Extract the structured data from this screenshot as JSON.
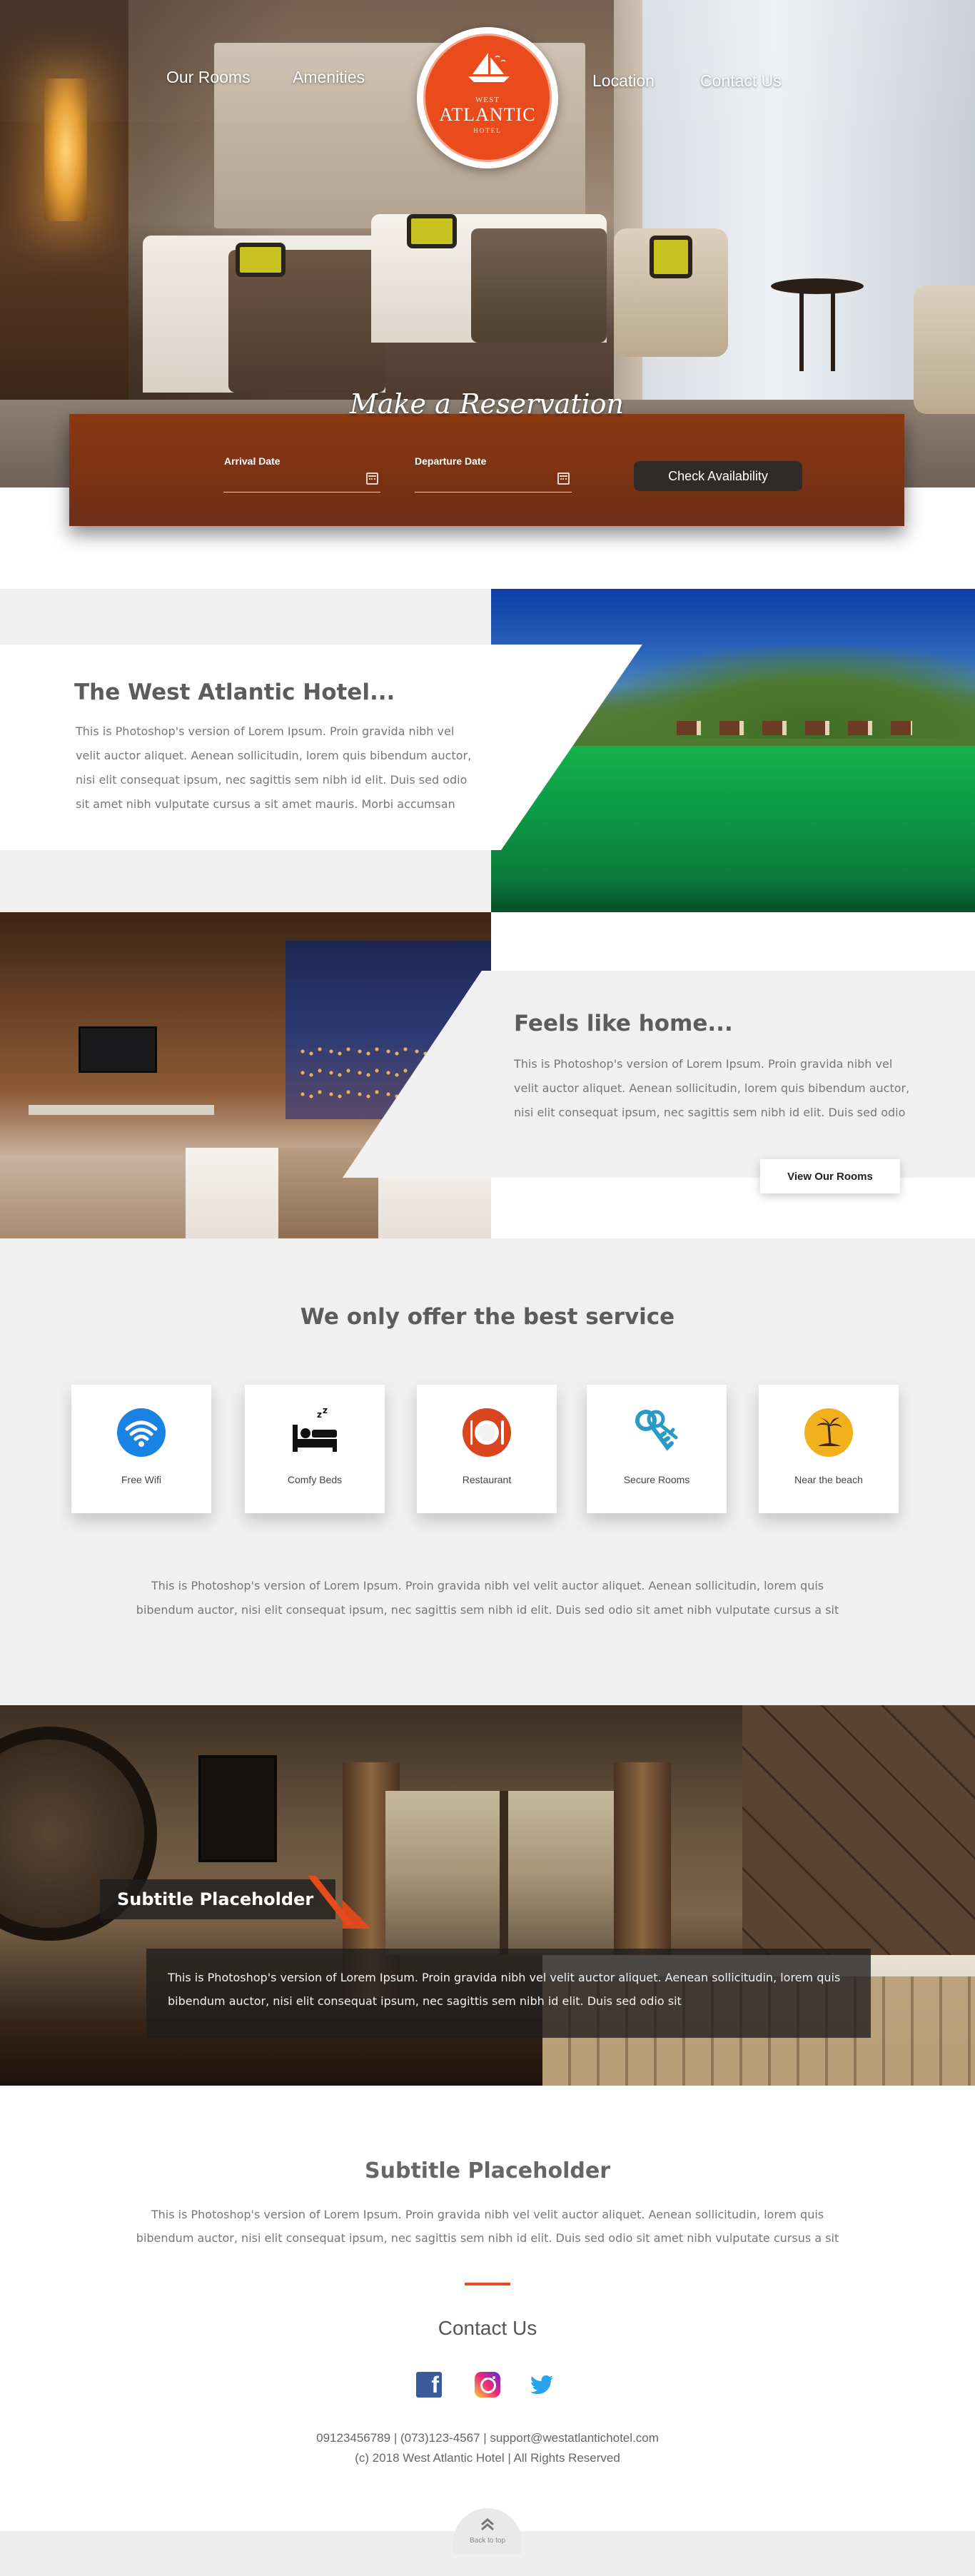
{
  "nav": {
    "items": [
      {
        "label": "Our Rooms"
      },
      {
        "label": "Amenities"
      },
      {
        "label": "Location"
      },
      {
        "label": "Contact Us"
      }
    ]
  },
  "logo": {
    "top": "WEST",
    "name": "ATLANTIC",
    "sub": "HOTEL"
  },
  "reservation": {
    "title": "Make a Reservation",
    "arrival_label": "Arrival Date",
    "departure_label": "Departure Date",
    "arrival_value": "",
    "departure_value": "",
    "button": "Check Availability"
  },
  "about": {
    "title": "The West Atlantic Hotel...",
    "text": "This is Photoshop's version  of Lorem Ipsum. Proin gravida nibh vel velit auctor aliquet. Aenean sollicitudin, lorem quis bibendum auctor, nisi elit consequat ipsum, nec sagittis sem nibh id elit. Duis sed odio sit amet nibh vulputate cursus a sit amet mauris. Morbi accumsan"
  },
  "home": {
    "title": "Feels like home...",
    "text": "This is Photoshop's version  of Lorem Ipsum. Proin gravida nibh vel velit auctor aliquet. Aenean sollicitudin, lorem quis bibendum auctor, nisi elit consequat ipsum, nec sagittis sem nibh id elit. Duis sed odio",
    "button": "View Our Rooms"
  },
  "services": {
    "title": "We only offer the best service",
    "items": [
      {
        "label": "Free Wifi",
        "icon": "wifi-icon",
        "color": "#1a82e2"
      },
      {
        "label": "Comfy Beds",
        "icon": "bed-icon",
        "color": "#111111"
      },
      {
        "label": "Restaurant",
        "icon": "restaurant-icon",
        "color": "#d9451e"
      },
      {
        "label": "Secure Rooms",
        "icon": "keys-icon",
        "color": "#2a9bc4"
      },
      {
        "label": "Near the beach",
        "icon": "beach-icon",
        "color": "#f2b01e"
      }
    ],
    "text": "This is Photoshop's version  of Lorem Ipsum. Proin gravida nibh vel velit auctor aliquet. Aenean sollicitudin, lorem quis bibendum auctor, nisi elit consequat ipsum, nec sagittis sem nibh id elit. Duis sed odio sit amet nibh vulputate cursus a sit"
  },
  "room": {
    "subtitle": "Subtitle Placeholder",
    "text": "This is Photoshop's version  of Lorem Ipsum. Proin gravida nibh vel velit auctor aliquet. Aenean sollicitudin, lorem quis bibendum auctor, nisi elit consequat ipsum, nec sagittis sem nibh id elit. Duis sed odio sit"
  },
  "footer": {
    "title": "Subtitle Placeholder",
    "text": "This is Photoshop's version  of Lorem Ipsum. Proin gravida nibh vel velit auctor aliquet. Aenean sollicitudin, lorem quis bibendum auctor, nisi elit consequat ipsum, nec sagittis sem nibh id elit. Duis sed odio sit amet nibh vulputate cursus a sit",
    "contact_title": "Contact Us",
    "phones_email": "09123456789 | (073)123-4567 | support@westatlantichotel.com",
    "copyright": "(c) 2018 West Atlantic Hotel | All Rights Reserved",
    "back_to_top": "Back to top"
  },
  "colors": {
    "accent": "#e74a1b",
    "reservation_bg": "#7a3214",
    "section_gray": "#f0f0f0"
  }
}
